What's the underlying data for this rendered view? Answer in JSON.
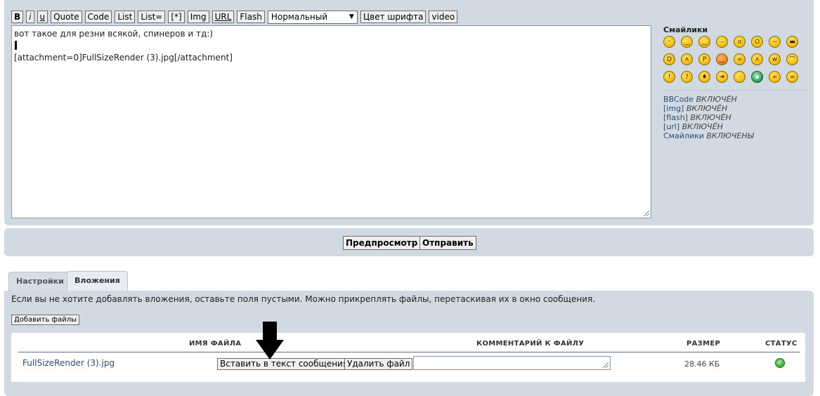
{
  "toolbar": {
    "bold": "B",
    "italic": "i",
    "underline": "u",
    "quote": "Quote",
    "code": "Code",
    "list": "List",
    "list_eq": "List=",
    "list_item": "[*]",
    "img": "Img",
    "url": "URL",
    "flash": "Flash",
    "size_select": "Нормальный",
    "font_color": "Цвет шрифта",
    "video": "video"
  },
  "editor": {
    "line1": "вот такое для резни всякой, спинеров и тд:)",
    "line3": "[attachment=0]FullSizeRender (3).jpg[/attachment]"
  },
  "sidebar": {
    "smilies_title": "Смайлики",
    "smilies": [
      "grin-icon",
      "smile-icon",
      "wink-icon",
      "neutral-icon",
      "surprised-icon",
      "eek-icon",
      "confused-icon",
      "cool-icon",
      "laugh-icon",
      "mad-icon",
      "razz-icon",
      "redface-icon",
      "rolleyes-icon",
      "evil-icon",
      "twisted-icon",
      "sad-icon",
      "exclaim-icon",
      "question-icon",
      "idea-icon",
      "arrow-icon",
      "neutral2-icon",
      "green-icon",
      "geek-icon",
      "uber-geek-icon"
    ],
    "status": [
      {
        "label": "BBCode",
        "value": "ВКЛЮЧЁН"
      },
      {
        "label": "[img]",
        "value": "ВКЛЮЧЁН"
      },
      {
        "label": "[flash]",
        "value": "ВКЛЮЧЁН"
      },
      {
        "label": "[url]",
        "value": "ВКЛЮЧЁН"
      },
      {
        "label": "Смайлики",
        "value": "ВКЛЮЧЕНЫ"
      }
    ]
  },
  "actions": {
    "preview": "Предпросмотр",
    "submit": "Отправить"
  },
  "tabs": {
    "settings": "Настройки",
    "attachments": "Вложения"
  },
  "attachments": {
    "info": "Если вы не хотите добавлять вложения, оставьте поля пустыми. Можно прикреплять файлы, перетаскивая их в окно сообщения.",
    "add_files": "Добавить файлы",
    "headers": {
      "filename": "ИМЯ ФАЙЛА",
      "comment": "КОММЕНТАРИЙ К ФАЙЛУ",
      "size": "РАЗМЕР",
      "status": "СТАТУС"
    },
    "row": {
      "filename": "FullSizeRender (3).jpg",
      "insert": "Вставить в текст сообщения",
      "delete": "Удалить файл",
      "comment": "",
      "size": "28.46 КБ"
    }
  }
}
